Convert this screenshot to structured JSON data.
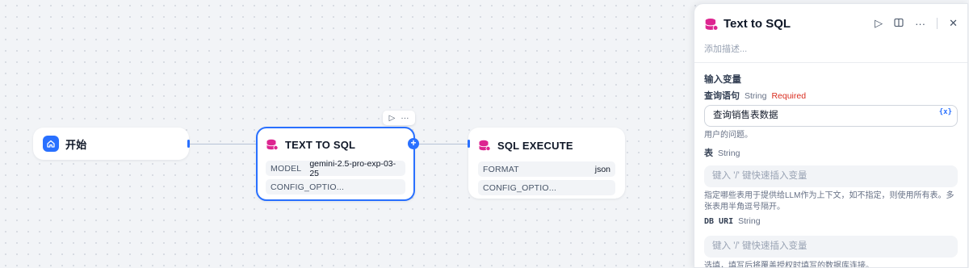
{
  "canvas": {
    "nodes": {
      "start": {
        "title": "开始",
        "icon": "home-icon"
      },
      "text_to_sql": {
        "title": "TEXT TO SQL",
        "icon": "database-icon",
        "params": [
          {
            "key": "MODEL",
            "value": "gemini-2.5-pro-exp-03-25"
          },
          {
            "key": "CONFIG_OPTIO...",
            "value": ""
          }
        ],
        "toolbar": {
          "run_icon": "play-icon",
          "more_icon": "more-icon"
        }
      },
      "sql_execute": {
        "title": "SQL EXECUTE",
        "icon": "database-icon",
        "params": [
          {
            "key": "FORMAT",
            "value": "json"
          },
          {
            "key": "CONFIG_OPTIO...",
            "value": ""
          }
        ]
      }
    }
  },
  "panel": {
    "title": "Text to SQL",
    "description_placeholder": "添加描述...",
    "actions": [
      "play-icon",
      "split-view-icon",
      "more-icon",
      "close-icon"
    ],
    "section_title": "输入变量",
    "fields": [
      {
        "name": "查询语句",
        "type": "String",
        "required": "Required",
        "value": "查询销售表数据",
        "var_button": "{x}",
        "hint": "用户的问题。"
      },
      {
        "name": "表",
        "type": "String",
        "placeholder": "键入 '/' 键快速插入变量",
        "hint": "指定哪些表用于提供给LLM作为上下文，如不指定，则使用所有表。多张表用半角逗号隔开。"
      },
      {
        "name": "DB URI",
        "type": "String",
        "placeholder": "键入 '/' 键快速插入变量",
        "hint": "选填，填写后将覆盖授权时填写的数据库连接。"
      }
    ]
  },
  "colors": {
    "accent": "#2970ff",
    "db_icon": "#dd2590",
    "required": "#d92d20"
  }
}
